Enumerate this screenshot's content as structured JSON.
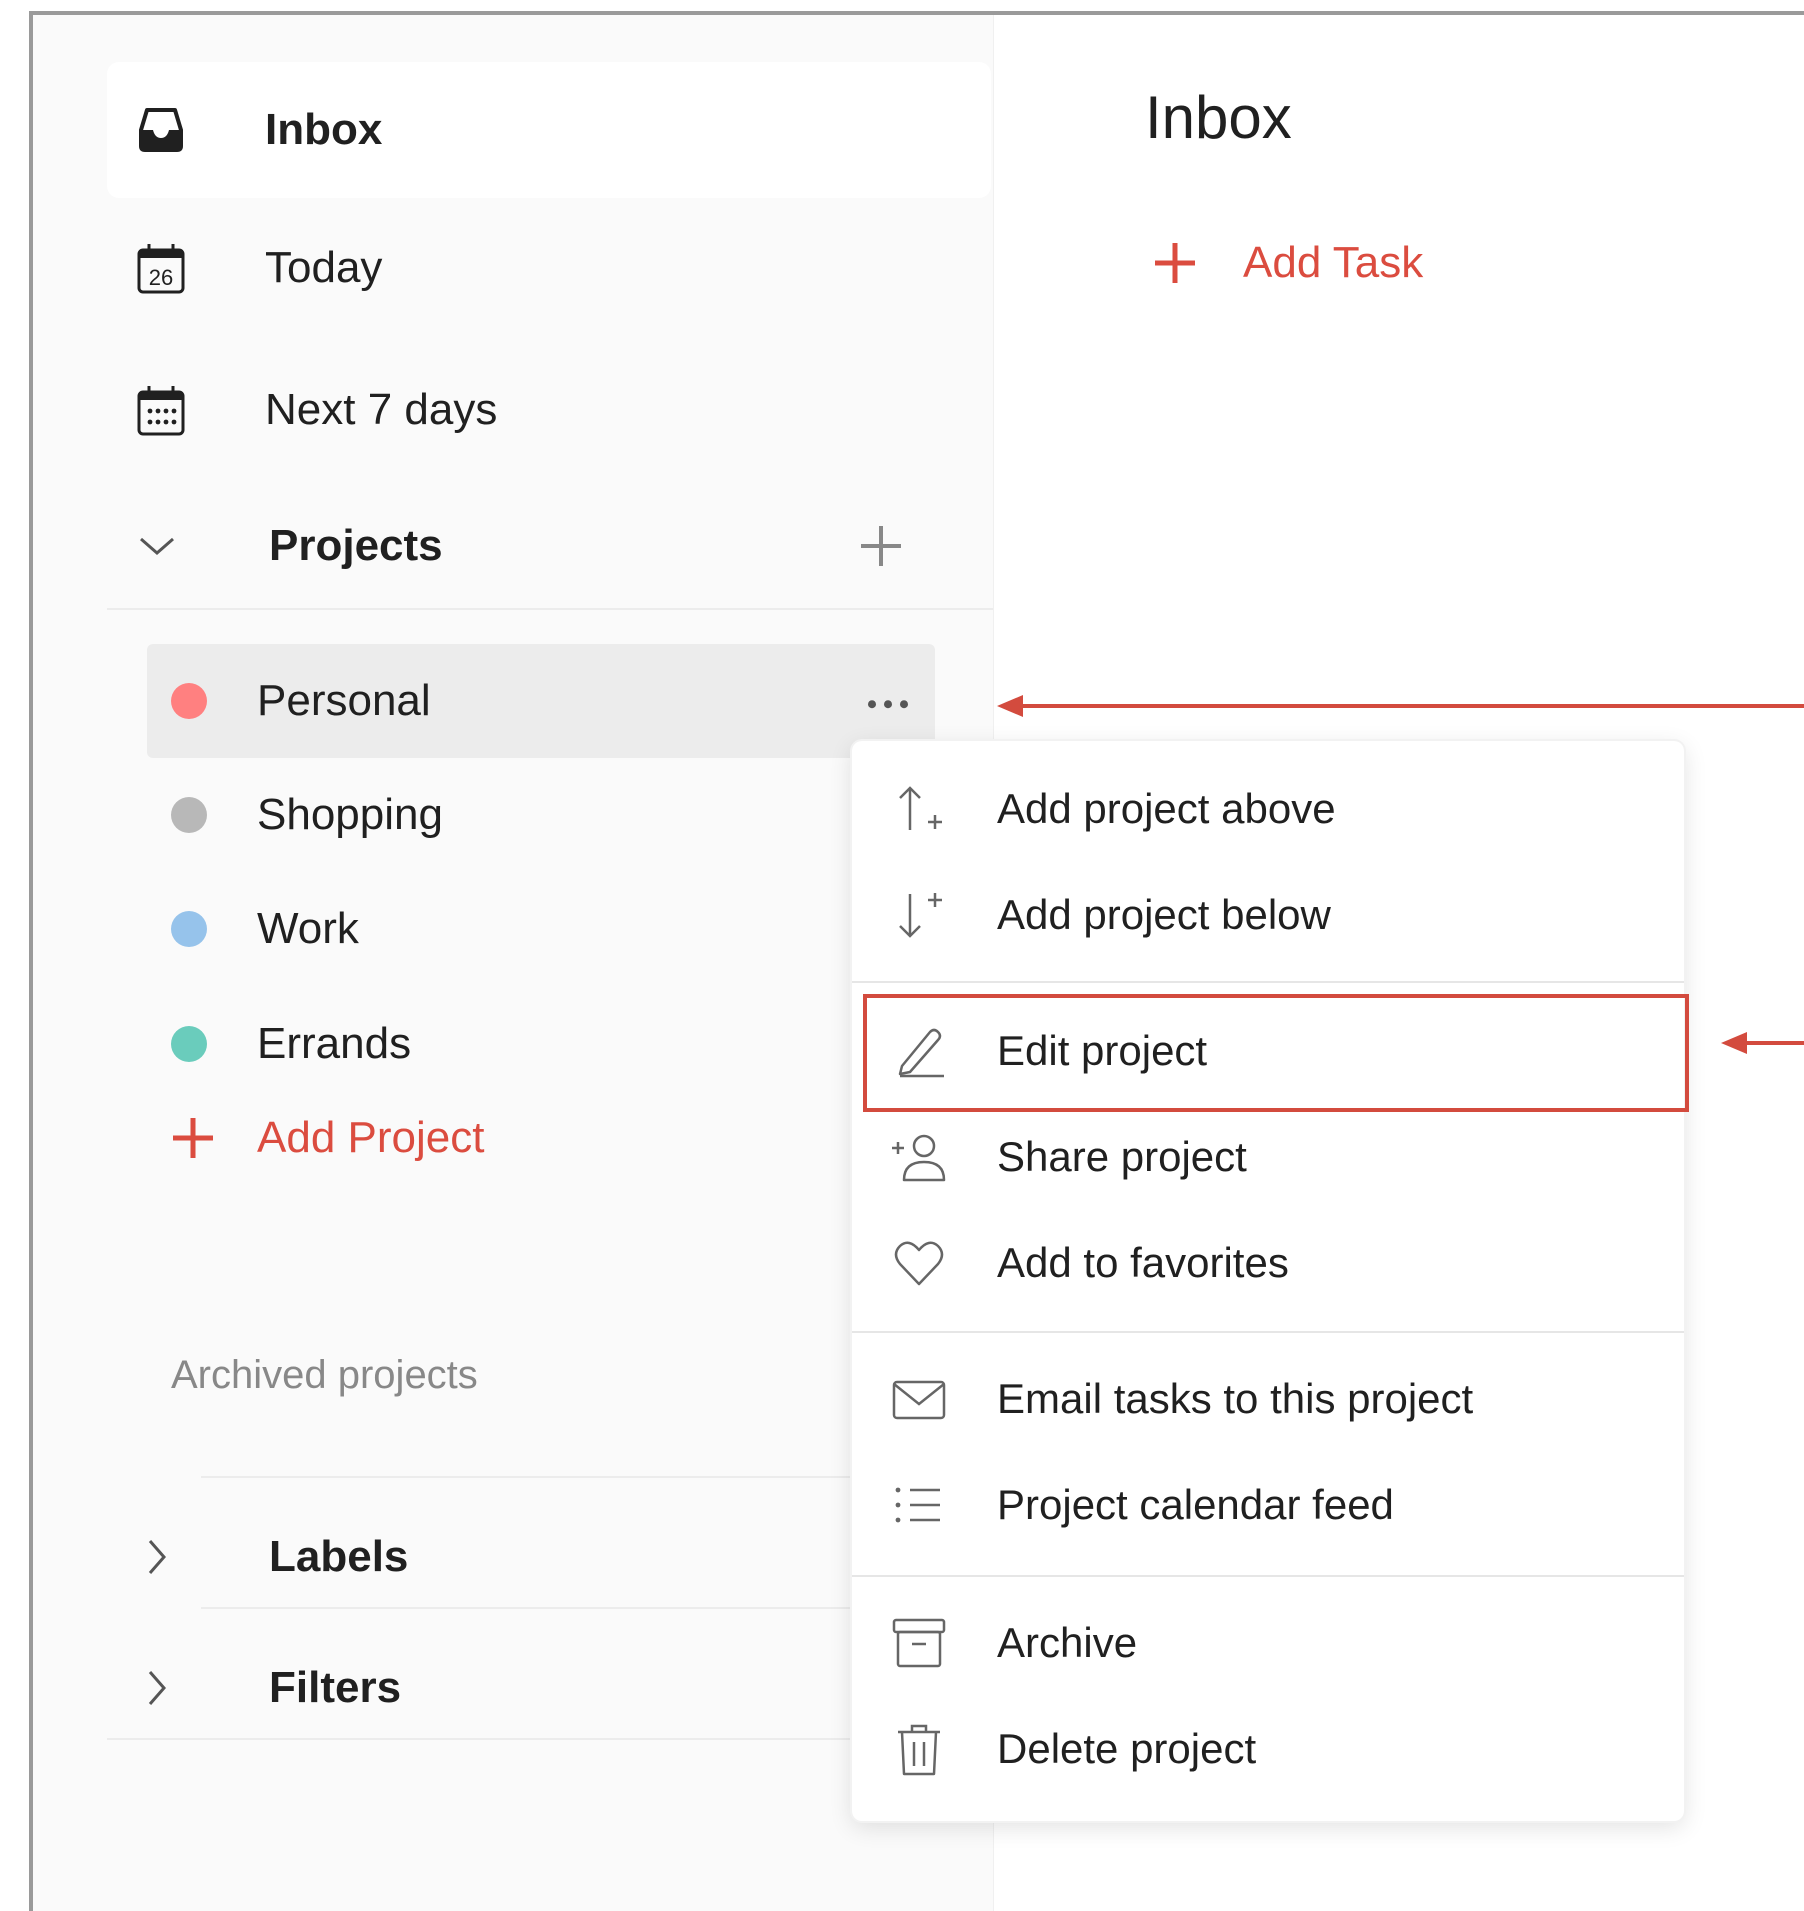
{
  "sidebar": {
    "nav": [
      {
        "label": "Inbox",
        "icon": "inbox-icon",
        "active": true
      },
      {
        "label": "Today",
        "icon": "calendar-today-icon",
        "day_number": "26"
      },
      {
        "label": "Next 7 days",
        "icon": "calendar-week-icon"
      }
    ],
    "projects_section": {
      "label": "Projects",
      "expanded": true,
      "items": [
        {
          "label": "Personal",
          "color": "#ff8080",
          "hovered": true
        },
        {
          "label": "Shopping",
          "color": "#b8b8b8"
        },
        {
          "label": "Work",
          "color": "#96c3eb"
        },
        {
          "label": "Errands",
          "color": "#6accbc"
        }
      ],
      "add_label": "Add Project",
      "archived_label": "Archived projects"
    },
    "labels_section": {
      "label": "Labels",
      "expanded": false
    },
    "filters_section": {
      "label": "Filters",
      "expanded": false
    }
  },
  "main": {
    "title": "Inbox",
    "add_task_label": "Add Task"
  },
  "context_menu": {
    "groups": [
      [
        {
          "label": "Add project above",
          "icon": "arrow-up-plus-icon"
        },
        {
          "label": "Add project below",
          "icon": "arrow-down-plus-icon"
        }
      ],
      [
        {
          "label": "Edit project",
          "icon": "pencil-icon",
          "highlighted": true
        },
        {
          "label": "Share project",
          "icon": "add-person-icon"
        },
        {
          "label": "Add to favorites",
          "icon": "heart-icon"
        }
      ],
      [
        {
          "label": "Email tasks to this project",
          "icon": "envelope-icon"
        },
        {
          "label": "Project calendar feed",
          "icon": "list-icon"
        }
      ],
      [
        {
          "label": "Archive",
          "icon": "archive-box-icon"
        },
        {
          "label": "Delete project",
          "icon": "trash-icon"
        }
      ]
    ]
  },
  "colors": {
    "accent": "#db4c3f",
    "annotation": "#d34b3e"
  }
}
